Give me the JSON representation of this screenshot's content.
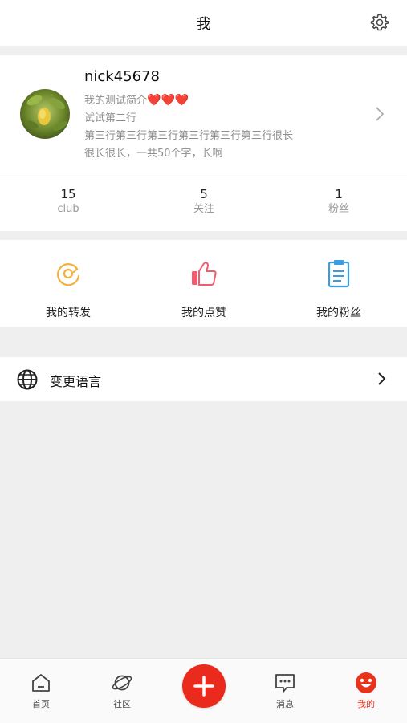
{
  "navbar": {
    "title": "我",
    "settings_icon": "gear-icon"
  },
  "profile": {
    "username": "nick45678",
    "bio_line1": "我的测试简介",
    "bio_line1_hearts": "❤️❤️❤️",
    "bio_line2": "试试第二行",
    "bio_line3": "第三行第三行第三行第三行第三行第三行很长",
    "bio_line4": "很长很长，一共50个字，长啊"
  },
  "stats": [
    {
      "value": "15",
      "label": "club"
    },
    {
      "value": "5",
      "label": "关注"
    },
    {
      "value": "1",
      "label": "粉丝"
    }
  ],
  "actions": [
    {
      "label": "我的转发",
      "icon": "forward-icon",
      "color": "#f3b03b"
    },
    {
      "label": "我的点赞",
      "icon": "thumbs-up-icon",
      "color": "#f25c6f"
    },
    {
      "label": "我的粉丝",
      "icon": "clipboard-icon",
      "color": "#3a9de0"
    }
  ],
  "settings": {
    "language_label": "变更语言",
    "language_icon": "globe-icon"
  },
  "tabbar": {
    "items": [
      {
        "label": "首页",
        "icon": "home-icon"
      },
      {
        "label": "社区",
        "icon": "planet-icon"
      },
      {
        "label": "",
        "icon": "plus-icon"
      },
      {
        "label": "消息",
        "icon": "message-icon"
      },
      {
        "label": "我的",
        "icon": "smiley-icon"
      }
    ],
    "active_color": "#e8321c",
    "fab_color": "#ea2a1d"
  }
}
